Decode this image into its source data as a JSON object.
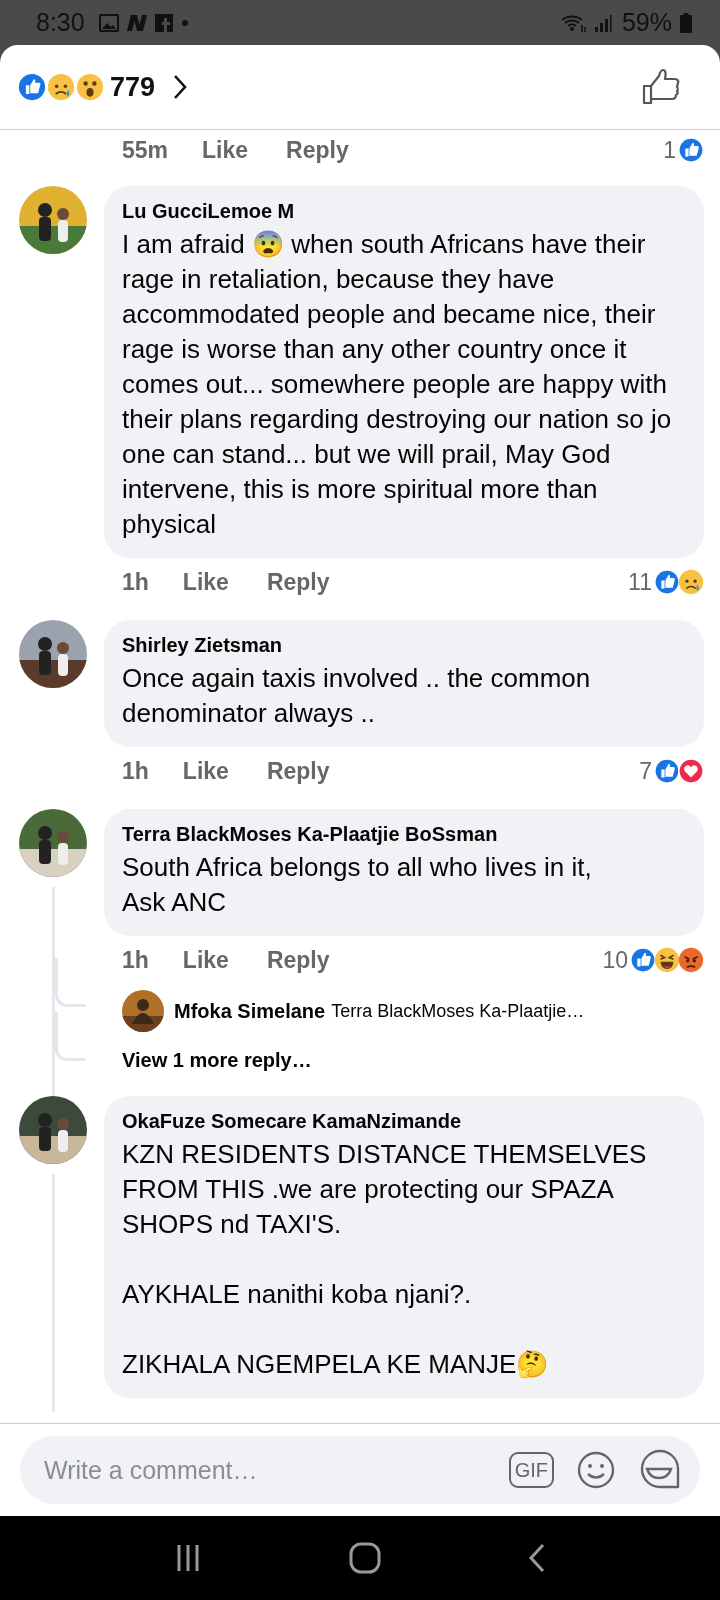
{
  "status_bar": {
    "time": "8:30",
    "battery": "59%"
  },
  "header": {
    "reactions": [
      {
        "kind": "like"
      },
      {
        "kind": "sad"
      },
      {
        "kind": "wow"
      }
    ],
    "count": "779"
  },
  "comments": [
    {
      "partial": true,
      "time": "55m",
      "like": "Like",
      "reply": "Reply",
      "reaction_count": "1",
      "reactions": [
        {
          "kind": "like"
        }
      ]
    },
    {
      "author": "Lu GucciLemoe M",
      "text": "I am afraid 😨 when south Africans have their rage in retaliation, because they have accommodated people and became nice, their rage is worse than any other country once it comes out... somewhere people are happy with their plans regarding destroying our nation so jo one can stand... but we will prail, May God intervene, this is more spiritual more than physical",
      "time": "1h",
      "like": "Like",
      "reply": "Reply",
      "reaction_count": "11",
      "reactions": [
        {
          "kind": "like"
        },
        {
          "kind": "sad"
        }
      ]
    },
    {
      "author": "Shirley Zietsman",
      "text": "Once again taxis involved .. the common denominator always ..",
      "time": "1h",
      "like": "Like",
      "reply": "Reply",
      "reaction_count": "7",
      "reactions": [
        {
          "kind": "like"
        },
        {
          "kind": "love"
        }
      ]
    },
    {
      "author": "Terra BlackMoses Ka-Plaatjie BoSsman",
      "text": "South Africa belongs to all who lives in it,\nAsk ANC",
      "time": "1h",
      "like": "Like",
      "reply": "Reply",
      "reaction_count": "10",
      "reactions": [
        {
          "kind": "like"
        },
        {
          "kind": "haha"
        },
        {
          "kind": "angry"
        }
      ],
      "threaded": true,
      "replies": [
        {
          "author": "Mfoka Simelane",
          "text": "Terra BlackMoses Ka-Plaatjie…"
        }
      ],
      "more_replies": "View 1 more reply…"
    },
    {
      "author": "OkaFuze Somecare KamaNzimande",
      "text": "KZN  RESIDENTS DISTANCE THEMSELVES FROM THIS .we are protecting our SPAZA SHOPS nd TAXI'S.\n\nAYKHALE nanithi koba njani?.\n\nZIKHALA NGEMPELA KE MANJE🤔",
      "threaded": true
    }
  ],
  "composer": {
    "placeholder": "Write a comment…",
    "gif": "GIF"
  }
}
